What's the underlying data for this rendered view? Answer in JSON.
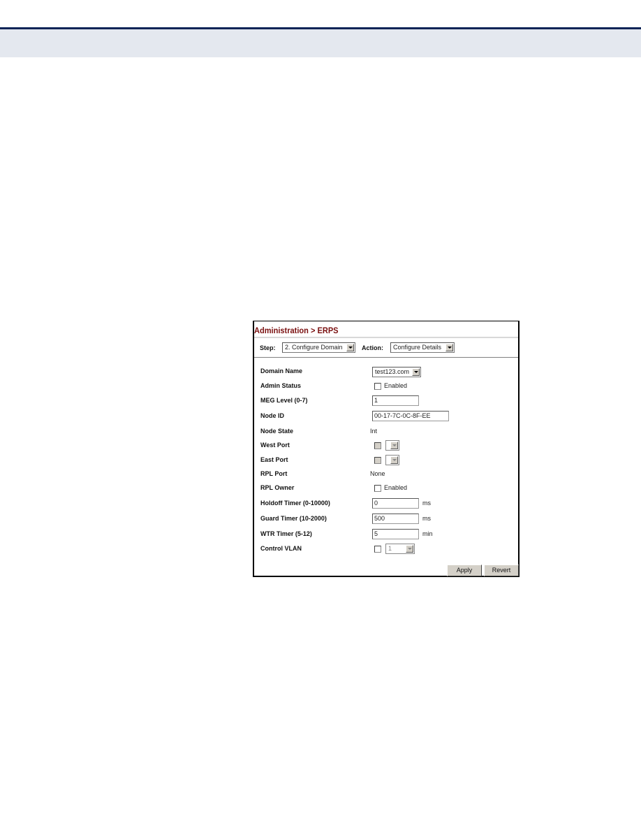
{
  "page": {
    "header_rule_color": "#0b2457",
    "header_band_color": "#e4e8ef"
  },
  "panel": {
    "title": "Administration > ERPS",
    "title_color": "#7a1010",
    "step": {
      "label": "Step:",
      "selected": "2. Configure Domain"
    },
    "action": {
      "label": "Action:",
      "selected": "Configure Details"
    },
    "fields": {
      "domain_name": {
        "label": "Domain Name",
        "selected": "test123.com"
      },
      "admin_status": {
        "label": "Admin Status",
        "checkbox_label": "Enabled",
        "checked": false
      },
      "meg_level": {
        "label": "MEG Level (0-7)",
        "value": "1"
      },
      "node_id": {
        "label": "Node ID",
        "value": "00-17-7C-0C-8F-EE"
      },
      "node_state": {
        "label": "Node State",
        "value": "Int"
      },
      "west_port": {
        "label": "West Port",
        "checked": false,
        "selected": ""
      },
      "east_port": {
        "label": "East Port",
        "checked": false,
        "selected": ""
      },
      "rpl_port": {
        "label": "RPL Port",
        "value": "None"
      },
      "rpl_owner": {
        "label": "RPL Owner",
        "checkbox_label": "Enabled",
        "checked": false
      },
      "holdoff_timer": {
        "label": "Holdoff Timer (0-10000)",
        "value": "0",
        "unit": "ms"
      },
      "guard_timer": {
        "label": "Guard Timer (10-2000)",
        "value": "500",
        "unit": "ms"
      },
      "wtr_timer": {
        "label": "WTR Timer (5-12)",
        "value": "5",
        "unit": "min"
      },
      "control_vlan": {
        "label": "Control VLAN",
        "checked": false,
        "selected": "1"
      }
    },
    "buttons": {
      "apply": "Apply",
      "revert": "Revert"
    }
  }
}
